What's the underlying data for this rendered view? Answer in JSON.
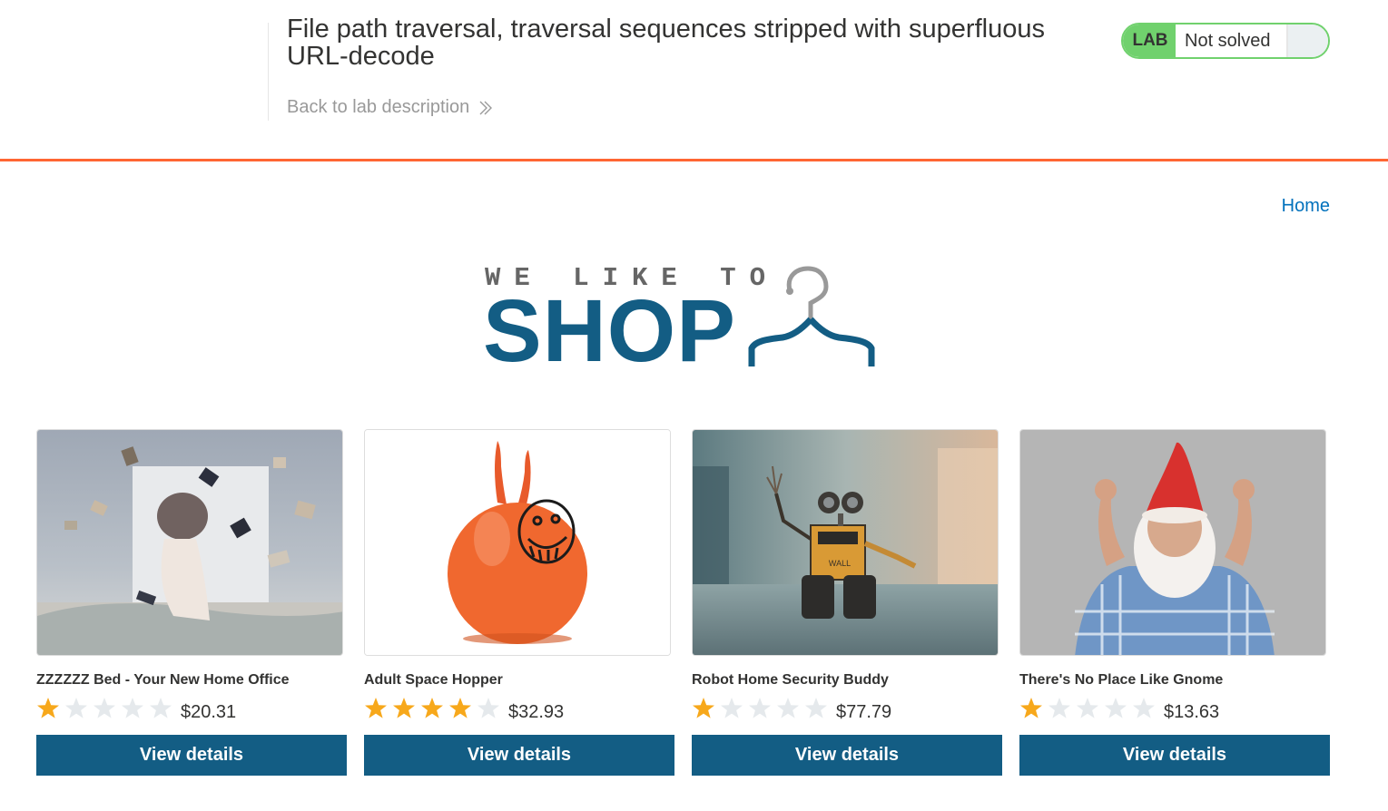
{
  "lab": {
    "title": "File path traversal, traversal sequences stripped with superfluous URL-decode",
    "back_link": "Back to lab description",
    "badge": "LAB",
    "status": "Not solved",
    "colors": {
      "accent": "#ff6633",
      "solved_green": "#70d16d"
    }
  },
  "nav": {
    "home": "Home"
  },
  "logo": {
    "tagline": "WE LIKE TO",
    "brand": "SHOP",
    "icon": "hanger-icon"
  },
  "products": [
    {
      "name": "ZZZZZZ Bed - Your New Home Office",
      "rating": 1,
      "price": "$20.31",
      "button": "View details",
      "image": "woman on bed with flying books"
    },
    {
      "name": "Adult Space Hopper",
      "rating": 4,
      "price": "$32.93",
      "button": "View details",
      "image": "orange space hopper"
    },
    {
      "name": "Robot Home Security Buddy",
      "rating": 1,
      "price": "$77.79",
      "button": "View details",
      "image": "toy robot on street"
    },
    {
      "name": "There's No Place Like Gnome",
      "rating": 1,
      "price": "$13.63",
      "button": "View details",
      "image": "man dressed as gnome"
    }
  ],
  "rating_max": 5,
  "colors": {
    "primary": "#135d84",
    "link": "#0071bc",
    "star_on": "#f7a81b",
    "star_off": "#e5e9ec"
  }
}
